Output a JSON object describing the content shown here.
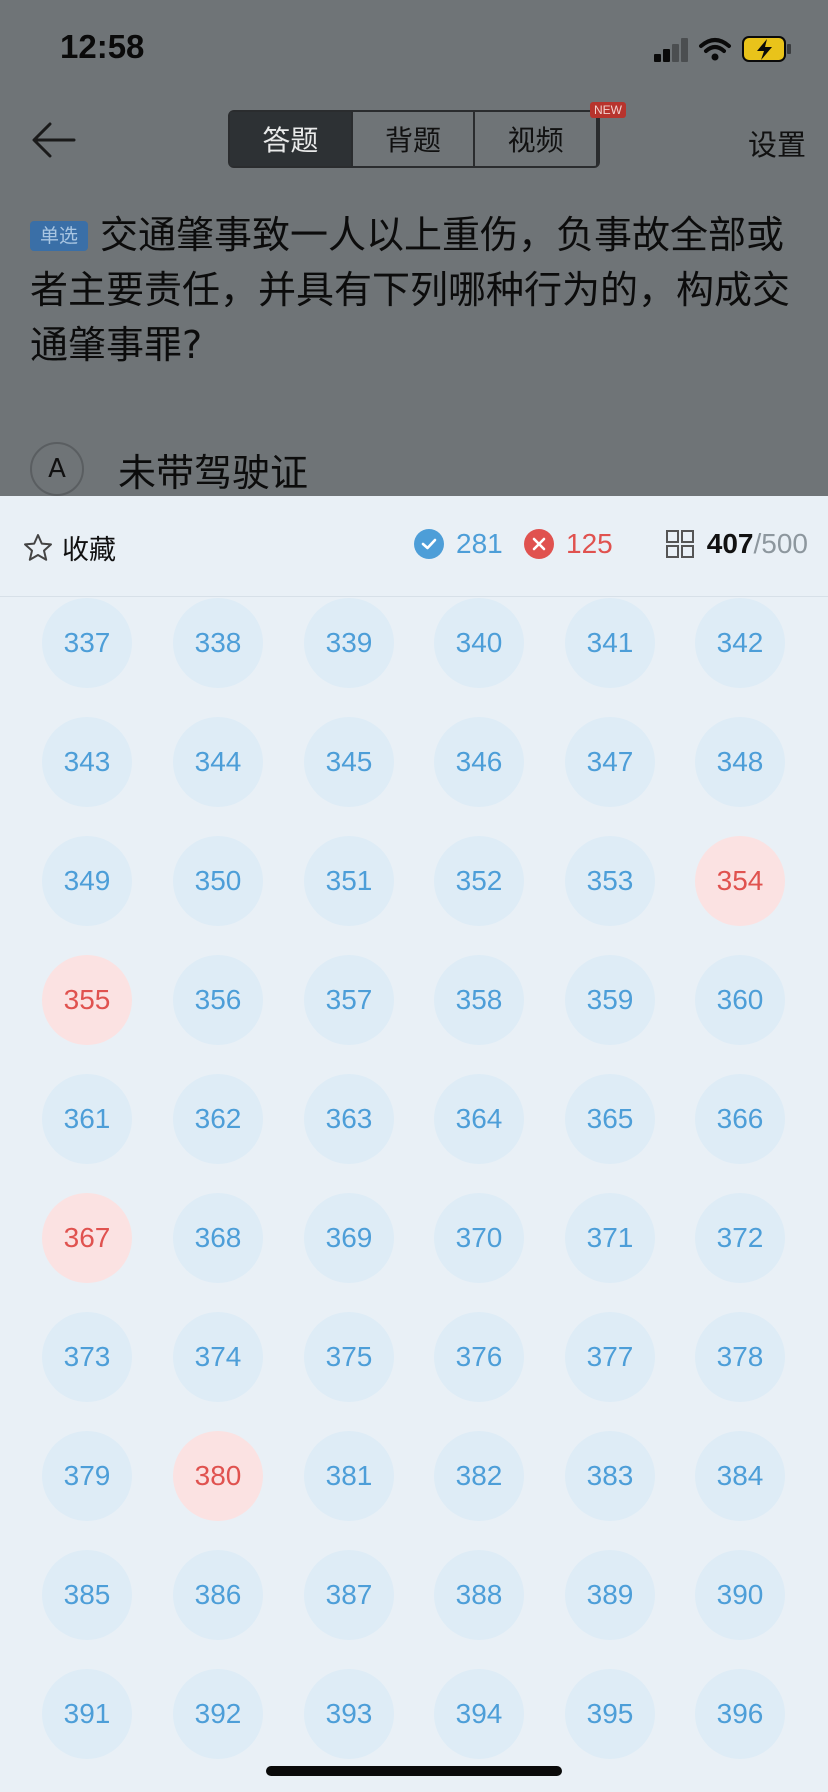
{
  "status": {
    "time": "12:58"
  },
  "nav": {
    "tabs": [
      {
        "label": "答题",
        "active": true
      },
      {
        "label": "背题",
        "active": false
      },
      {
        "label": "视频",
        "active": false,
        "badge": "NEW"
      }
    ],
    "settings_label": "设置"
  },
  "question": {
    "tag": "单选",
    "text": "交通肇事致一人以上重伤，负事故全部或者主要责任，并具有下列哪种行为的，构成交通肇事罪?",
    "option_a": {
      "letter": "A",
      "text": "未带驾驶证"
    }
  },
  "sheet": {
    "favorite_label": "收藏",
    "correct_count": "281",
    "wrong_count": "125",
    "progress_current": "407",
    "progress_total": "/500",
    "colors": {
      "correct": "#4d9ed8",
      "wrong": "#e0524f"
    },
    "numbers": [
      "337",
      "338",
      "339",
      "340",
      "341",
      "342",
      "343",
      "344",
      "345",
      "346",
      "347",
      "348",
      "349",
      "350",
      "351",
      "352",
      "353",
      "354",
      "355",
      "356",
      "357",
      "358",
      "359",
      "360",
      "361",
      "362",
      "363",
      "364",
      "365",
      "366",
      "367",
      "368",
      "369",
      "370",
      "371",
      "372",
      "373",
      "374",
      "375",
      "376",
      "377",
      "378",
      "379",
      "380",
      "381",
      "382",
      "383",
      "384",
      "385",
      "386",
      "387",
      "388",
      "389",
      "390",
      "391",
      "392",
      "393",
      "394",
      "395",
      "396"
    ],
    "wrong_numbers": [
      "354",
      "355",
      "367",
      "380"
    ]
  }
}
